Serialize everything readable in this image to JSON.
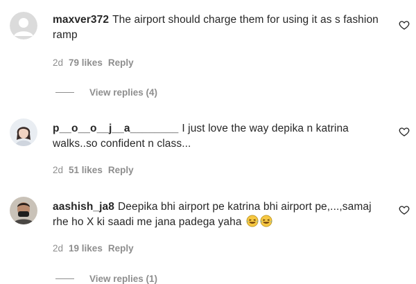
{
  "comments": [
    {
      "username": "maxver372",
      "text": "The airport should charge them for using it as s fashion ramp",
      "age": "2d",
      "likes": "79 likes",
      "reply_label": "Reply",
      "view_replies": "View replies (4)",
      "avatar": "default-avatar"
    },
    {
      "username": "p__o__o__j__a________",
      "text": "I just love the way depika n katrina walks..so confident n class...",
      "age": "2d",
      "likes": "51 likes",
      "reply_label": "Reply",
      "avatar": "profile-photo"
    },
    {
      "username": "aashish_ja8",
      "text": "Deepika bhi airport pe katrina bhi airport pe,...,samaj rhe ho X ki saadi me jana padega yaha",
      "emojis": [
        "😂",
        "😂"
      ],
      "age": "2d",
      "likes": "19 likes",
      "reply_label": "Reply",
      "view_replies": "View replies (1)",
      "avatar": "profile-photo"
    }
  ],
  "icons": {
    "like": "heart-outline-icon"
  },
  "colors": {
    "text": "#262626",
    "secondary": "#8e8e8e",
    "background": "#ffffff"
  }
}
